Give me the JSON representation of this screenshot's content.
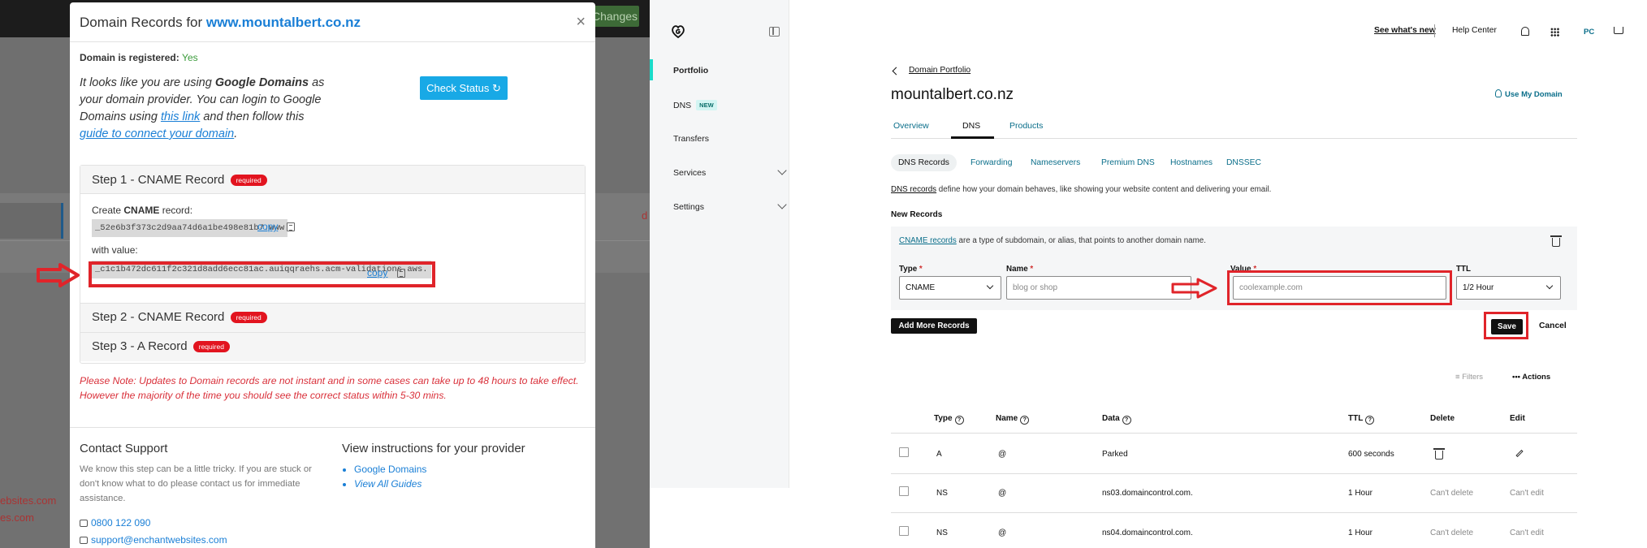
{
  "left": {
    "background": {
      "changes_btn": "Changes"
    },
    "modal": {
      "title_prefix": "Domain Records for ",
      "title_domain": "www.mountalbert.co.nz",
      "close": "×",
      "registered_label": "Domain is registered:",
      "registered_value": "Yes",
      "intro_1": "It looks like you are using ",
      "intro_bold": "Google Domains",
      "intro_2": " as your domain provider. You can login to Google Domains using ",
      "intro_link1": "this link",
      "intro_3": " and then follow this ",
      "intro_link2": "guide to connect your domain",
      "intro_4": ".",
      "check_status": "Check Status ↻",
      "step1_title": "Step 1 - CNAME Record",
      "required": "required",
      "create_prefix": "Create ",
      "create_bold": "CNAME",
      "create_suffix": " record:",
      "cname_name": "_52e6b3f373c2d9aa74d6a1be498e81b7.www",
      "copy": "copy",
      "with_value": "with value:",
      "cname_value": "_c1c1b472dc611f2c321d8add6ecc81ac.auiqqraehs.acm-validations.aws.",
      "step2_title": "Step 2 - CNAME Record",
      "step3_title": "Step 3 - A Record",
      "note": "Please Note: Updates to Domain records are not instant and in some cases can take up to 48 hours to take effect. However the majority of the time you should see the correct status within 5-30 mins.",
      "support_title": "Contact Support",
      "support_text": "We know this step can be a little tricky. If you are stuck or don't know what to do please contact us for immediate assistance.",
      "phone": "0800 122 090",
      "email": "support@enchantwebsites.com",
      "instr_title": "View instructions for your provider",
      "instr_links": [
        "Google Domains",
        "View All Guides"
      ]
    },
    "bg_links": [
      "ebsites.com",
      "es.com"
    ],
    "bg_d": "d"
  },
  "sidebar": {
    "items": [
      {
        "label": "Portfolio"
      },
      {
        "label": "DNS",
        "badge": "NEW"
      },
      {
        "label": "Transfers"
      },
      {
        "label": "Services"
      },
      {
        "label": "Settings"
      }
    ]
  },
  "right": {
    "topnav": {
      "whats_new": "See what's new",
      "help": "Help Center",
      "avatar": "PC"
    },
    "breadcrumb": "Domain Portfolio",
    "domain": "mountalbert.co.nz",
    "use_my_domain": "Use My Domain",
    "tabs": [
      "Overview",
      "DNS",
      "Products"
    ],
    "subtabs": [
      "DNS Records",
      "Forwarding",
      "Nameservers",
      "Premium DNS",
      "Hostnames",
      "DNSSEC"
    ],
    "desc_link": "DNS records",
    "desc_text": " define how your domain behaves, like showing your website content and delivering your email.",
    "new_records": "New Records",
    "cname_link": "CNAME records",
    "cname_text": " are a type of subdomain, or alias, that points to another domain name.",
    "form": {
      "type_label": "Type",
      "type_value": "CNAME",
      "name_label": "Name",
      "name_placeholder": "blog or shop",
      "value_label": "Value",
      "value_placeholder": "coolexample.com",
      "ttl_label": "TTL",
      "ttl_value": "1/2 Hour",
      "req": "*"
    },
    "add_more": "Add More Records",
    "save": "Save",
    "cancel": "Cancel",
    "filters": "Filters",
    "actions": "Actions",
    "table": {
      "headers": [
        "Type",
        "Name",
        "Data",
        "TTL",
        "Delete",
        "Edit"
      ],
      "rows": [
        {
          "type": "A",
          "name": "@",
          "data": "Parked",
          "ttl": "600 seconds",
          "delete": "",
          "edit": ""
        },
        {
          "type": "NS",
          "name": "@",
          "data": "ns03.domaincontrol.com.",
          "ttl": "1 Hour",
          "delete": "Can't delete",
          "edit": "Can't edit"
        },
        {
          "type": "NS",
          "name": "@",
          "data": "ns04.domaincontrol.com.",
          "ttl": "1 Hour",
          "delete": "Can't delete",
          "edit": "Can't edit"
        }
      ]
    }
  }
}
